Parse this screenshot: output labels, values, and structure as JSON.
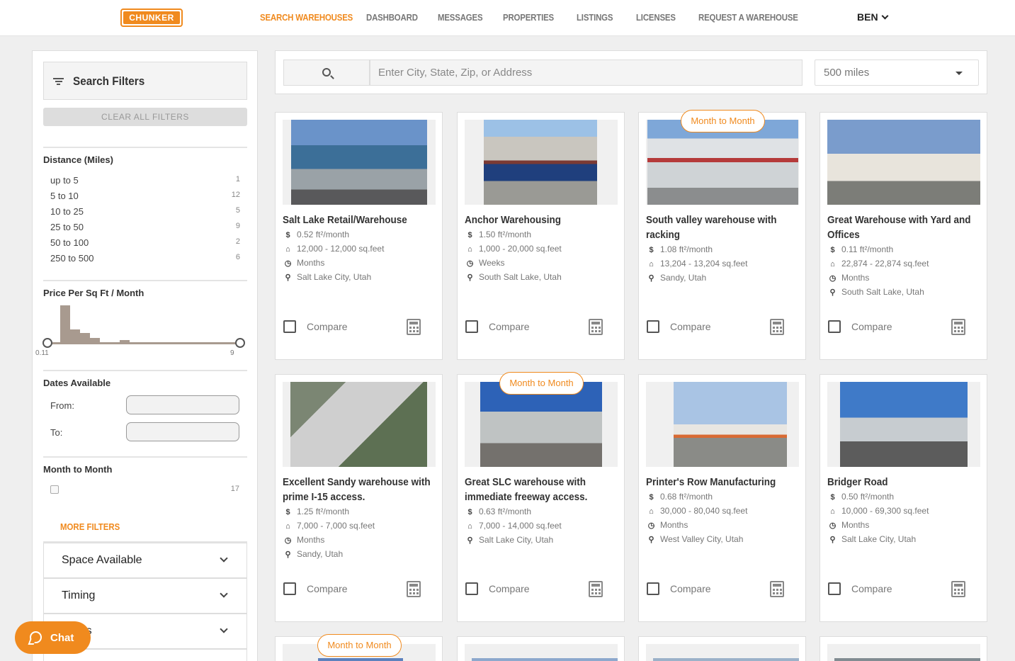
{
  "brand": {
    "logo_text": "CHUNKER"
  },
  "nav": {
    "items": [
      "SEARCH WAREHOUSES",
      "DASHBOARD",
      "MESSAGES",
      "PROPERTIES",
      "LISTINGS",
      "LICENSES",
      "REQUEST A WAREHOUSE"
    ],
    "active": "SEARCH WAREHOUSES",
    "user": "BEN"
  },
  "colors": {
    "accent": "#f08a1e",
    "histogram": "#a89a8f"
  },
  "sidebar": {
    "title": "Search Filters",
    "clear_label": "CLEAR ALL FILTERS",
    "distance": {
      "title": "Distance (Miles)",
      "rows": [
        {
          "label": "up to 5",
          "count": "1"
        },
        {
          "label": "5 to 10",
          "count": "12"
        },
        {
          "label": "10 to 25",
          "count": "5"
        },
        {
          "label": "25 to 50",
          "count": "9"
        },
        {
          "label": "50 to 100",
          "count": "2"
        },
        {
          "label": "250 to 500",
          "count": "6"
        }
      ]
    },
    "price": {
      "title": "Price Per Sq Ft / Month",
      "min": "0.11",
      "max": "9"
    },
    "dates": {
      "title": "Dates Available",
      "from_label": "From:",
      "to_label": "To:"
    },
    "month_to_month": {
      "title": "Month to Month",
      "count": "17"
    },
    "more_filters": "MORE FILTERS",
    "accordions": [
      "Space Available",
      "Timing",
      "Doors"
    ]
  },
  "chat": {
    "label": "Chat"
  },
  "search": {
    "placeholder": "Enter City, State, Zip, or Address",
    "radius": "500 miles"
  },
  "cards": [
    {
      "title": "Salt Lake Retail/Warehouse",
      "price": "0.52 ft²/month",
      "size": "12,000 - 12,000 sq.feet",
      "term": "Months",
      "location": "Salt Lake City, Utah",
      "badge": "",
      "compare": "Compare"
    },
    {
      "title": "Anchor Warehousing",
      "price": "1.50 ft²/month",
      "size": "1,000 - 20,000 sq.feet",
      "term": "Weeks",
      "location": "South Salt Lake, Utah",
      "badge": "",
      "compare": "Compare"
    },
    {
      "title": "South valley warehouse with racking",
      "price": "1.08 ft²/month",
      "size": "13,204 - 13,204 sq.feet",
      "term": "",
      "location": "Sandy, Utah",
      "badge": "Month to Month",
      "compare": "Compare"
    },
    {
      "title": "Great Warehouse with Yard and Offices",
      "price": "0.11 ft²/month",
      "size": "22,874 - 22,874 sq.feet",
      "term": "Months",
      "location": "South Salt Lake, Utah",
      "badge": "",
      "compare": "Compare"
    },
    {
      "title": "Excellent Sandy warehouse with prime I-15 access.",
      "price": "1.25 ft²/month",
      "size": "7,000 - 7,000 sq.feet",
      "term": "Months",
      "location": "Sandy, Utah",
      "badge": "",
      "compare": "Compare"
    },
    {
      "title": "Great SLC warehouse with immediate freeway access.",
      "price": "0.63 ft²/month",
      "size": "7,000 - 14,000 sq.feet",
      "term": "",
      "location": "Salt Lake City, Utah",
      "badge": "Month to Month",
      "compare": "Compare"
    },
    {
      "title": "Printer's Row Manufacturing",
      "price": "0.68 ft²/month",
      "size": "30,000 - 80,040 sq.feet",
      "term": "Months",
      "location": "West Valley City, Utah",
      "badge": "",
      "compare": "Compare"
    },
    {
      "title": "Bridger Road",
      "price": "0.50 ft²/month",
      "size": "10,000 - 69,300 sq.feet",
      "term": "Months",
      "location": "Salt Lake City, Utah",
      "badge": "",
      "compare": "Compare"
    }
  ],
  "partial_cards": [
    {
      "badge": "Month to Month"
    },
    {
      "badge": ""
    },
    {
      "badge": ""
    },
    {
      "badge": ""
    }
  ]
}
